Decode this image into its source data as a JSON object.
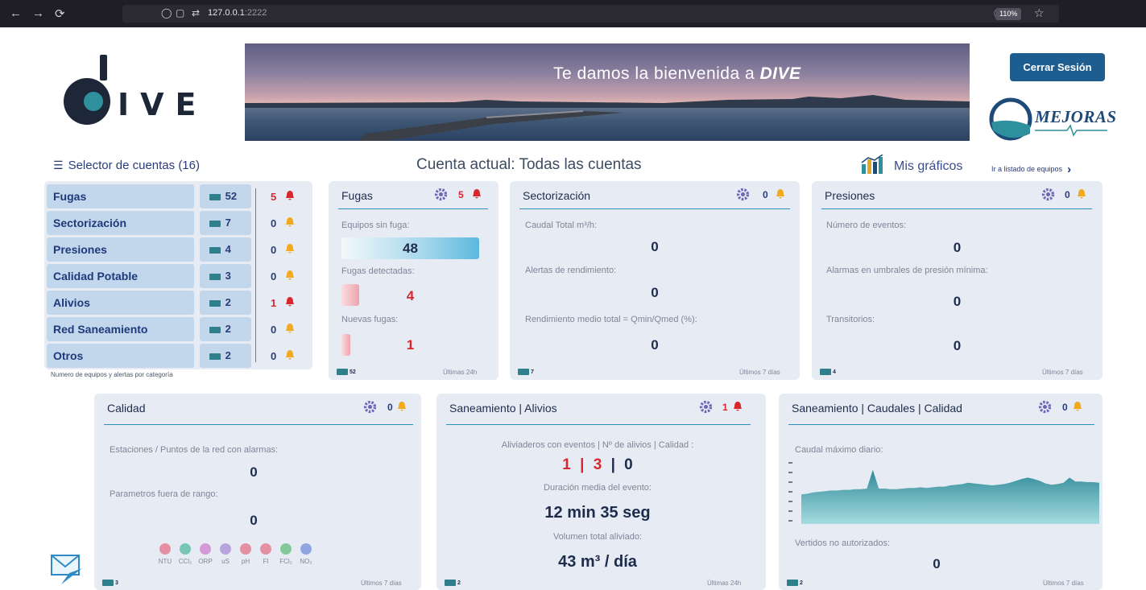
{
  "browser": {
    "url_host": "127.0.0.1",
    "url_port": ":2222",
    "zoom": "110%"
  },
  "header": {
    "logo_text": "IVE",
    "banner_title": "Te damos la bienvenida a",
    "banner_brand": "DIVE",
    "logout": "Cerrar Sesión",
    "partner_logo": "MEJORAS"
  },
  "subheader": {
    "selector": "Selector de cuentas (16)",
    "cuenta": "Cuenta actual: Todas las cuentas",
    "mis_graficos": "Mis gráficos",
    "ir_listado": "Ir a listado de equipos"
  },
  "categories": [
    {
      "label": "Fugas",
      "count": "52",
      "alerts": "5",
      "alert_color": "#d8272f"
    },
    {
      "label": "Sectorización",
      "count": "7",
      "alerts": "0",
      "alert_color": "#f2a91e"
    },
    {
      "label": "Presiones",
      "count": "4",
      "alerts": "0",
      "alert_color": "#f2a91e"
    },
    {
      "label": "Calidad Potable",
      "count": "3",
      "alerts": "0",
      "alert_color": "#f2a91e"
    },
    {
      "label": "Alivios",
      "count": "2",
      "alerts": "1",
      "alert_color": "#d8272f"
    },
    {
      "label": "Red Saneamiento",
      "count": "2",
      "alerts": "0",
      "alert_color": "#f2a91e"
    },
    {
      "label": "Otros",
      "count": "2",
      "alerts": "0",
      "alert_color": "#f2a91e"
    }
  ],
  "categories_footer": "Numero de equipos y alertas por categoría",
  "fugas": {
    "title": "Fugas",
    "alerts": "5",
    "sin_fuga_label": "Equipos sin fuga:",
    "sin_fuga": "48",
    "detectadas_label": "Fugas detectadas:",
    "detectadas": "4",
    "nuevas_label": "Nuevas fugas:",
    "nuevas": "1",
    "equipos": "52",
    "period": "Últimas 24h"
  },
  "sectorizacion": {
    "title": "Sectorización",
    "alerts": "0",
    "caudal_label": "Caudal Total m³/h:",
    "caudal": "0",
    "rend_label": "Alertas de rendimiento:",
    "rend": "0",
    "medio_label": "Rendimiento medio total = Qmin/Qmed (%):",
    "medio": "0",
    "equipos": "7",
    "period": "Últimos 7 días"
  },
  "presiones": {
    "title": "Presiones",
    "alerts": "0",
    "eventos_label": "Número de eventos:",
    "eventos": "0",
    "umbral_label": "Alarmas en umbrales de presión mínima:",
    "umbral": "0",
    "trans_label": "Transitorios:",
    "trans": "0",
    "equipos": "4",
    "period": "Últimos 7 días"
  },
  "calidad": {
    "title": "Calidad",
    "alerts": "0",
    "estaciones_label": "Estaciones / Puntos de la red con alarmas:",
    "estaciones": "0",
    "params_label": "Parametros fuera de rango:",
    "params": "0",
    "indicators": [
      "NTU",
      "CCl₂",
      "ORP",
      "uS",
      "pH",
      "Fl",
      "FCl₂",
      "NO₃"
    ],
    "indicator_colors": [
      "#e58fa2",
      "#76c5b6",
      "#d49ad8",
      "#b7a4de",
      "#e58fa2",
      "#e58fa2",
      "#84c99a",
      "#8fa6e3"
    ],
    "equipos": "3",
    "period": "Últimos 7 días"
  },
  "alivios": {
    "title": "Saneamiento | Alivios",
    "alerts": "1",
    "eventos_label": "Aliviaderos con eventos | Nº de alivios | Calidad :",
    "aliviaderos": "1",
    "n_alivios": "3",
    "calidad": "0",
    "sep": "|",
    "duracion_label": "Duración media del evento:",
    "duracion": "12 min 35 seg",
    "volumen_label": "Volumen total aliviado:",
    "volumen": "43 m³ / día",
    "equipos": "2",
    "period": "Últimas 24h"
  },
  "caudales": {
    "title": "Saneamiento | Caudales | Calidad",
    "alerts": "0",
    "maximo_label": "Caudal máximo diario:",
    "vertidos_label": "Vertidos no autorizados:",
    "vertidos": "0",
    "equipos": "2",
    "period": "Últimos 7 días",
    "series": [
      46,
      47,
      49,
      50,
      51,
      52,
      52,
      53,
      53,
      54,
      54,
      55,
      84,
      55,
      55,
      54,
      54,
      55,
      56,
      56,
      57,
      56,
      57,
      58,
      58,
      60,
      61,
      62,
      64,
      63,
      62,
      61,
      60,
      61,
      62,
      64,
      67,
      70,
      72,
      70,
      67,
      63,
      61,
      62,
      64,
      72,
      66,
      66,
      65,
      65,
      64
    ]
  },
  "colors": {
    "accent": "#2a8fbf",
    "card_bg": "#e7ecf4",
    "label_bg": "#c2d6ec",
    "alarm_red": "#d8272f",
    "bell_amber": "#f2a91e",
    "logout_bg": "#1e5d8f"
  }
}
